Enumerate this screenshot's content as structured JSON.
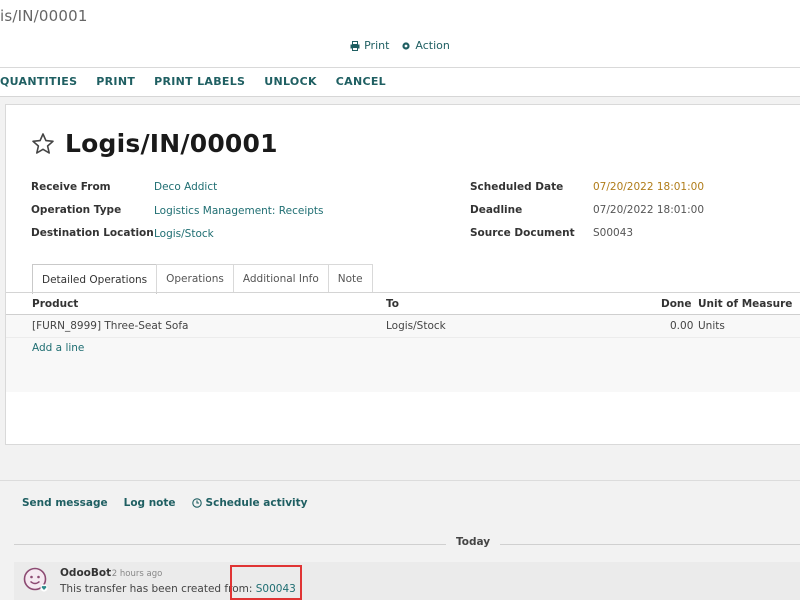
{
  "breadcrumb": "is/IN/00001",
  "top_actions": {
    "print": "Print",
    "action": "Action"
  },
  "statusbar": {
    "buttons": [
      "QUANTITIES",
      "PRINT",
      "PRINT LABELS",
      "UNLOCK",
      "CANCEL"
    ]
  },
  "record": {
    "title": "Logis/IN/00001",
    "fields_left": [
      {
        "label": "Receive From",
        "value": "Deco Addict"
      },
      {
        "label": "Operation Type",
        "value": "Logistics Management: Receipts"
      },
      {
        "label": "Destination Location",
        "value": "Logis/Stock"
      }
    ],
    "fields_right": [
      {
        "label": "Scheduled Date",
        "value": "07/20/2022 18:01:00"
      },
      {
        "label": "Deadline",
        "value": "07/20/2022 18:01:00"
      },
      {
        "label": "Source Document",
        "value": "S00043"
      }
    ]
  },
  "tabs": [
    "Detailed Operations",
    "Operations",
    "Additional Info",
    "Note"
  ],
  "operations": {
    "headers": {
      "product": "Product",
      "to": "To",
      "done": "Done",
      "uom": "Unit of Measure"
    },
    "rows": [
      {
        "product": "[FURN_8999] Three-Seat Sofa",
        "to": "Logis/Stock",
        "done": "0.00",
        "uom": "Units"
      }
    ],
    "add_line": "Add a line"
  },
  "chatter": {
    "send_message": "Send message",
    "log_note": "Log note",
    "schedule_activity": "Schedule activity",
    "separator": "Today",
    "message": {
      "author": "OdooBot",
      "time": "- 2 hours ago",
      "text": "This transfer has been created from:",
      "link": "S00043"
    }
  },
  "colors": {
    "link": "#1f6e72",
    "warning_date": "#b07c19",
    "highlight": "#e03434"
  }
}
